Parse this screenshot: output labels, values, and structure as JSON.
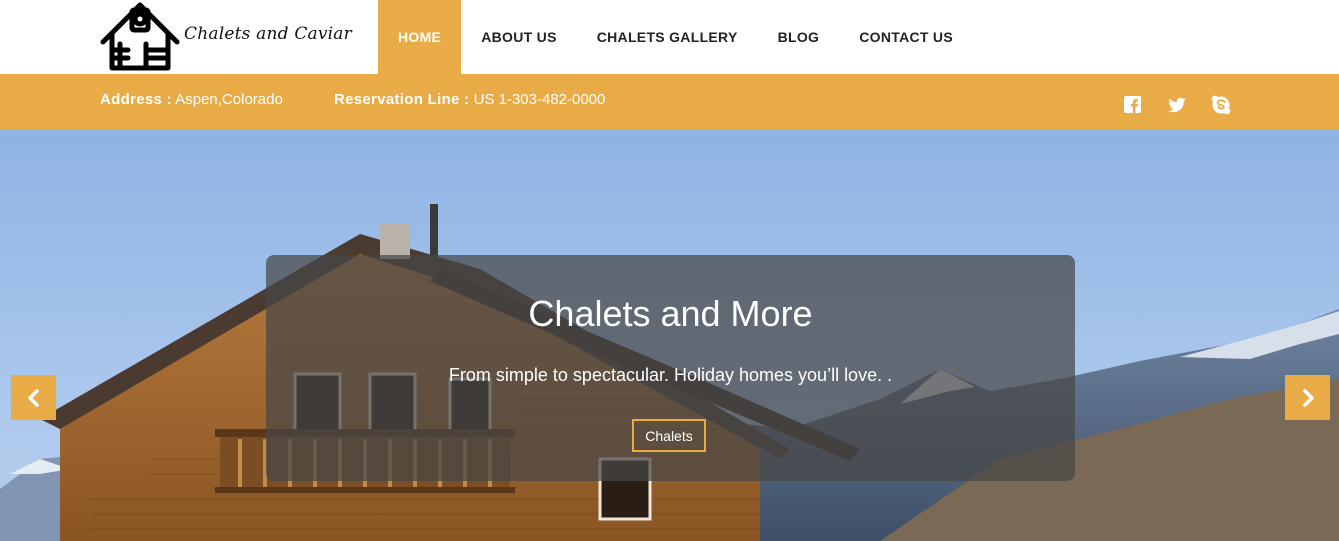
{
  "brand": {
    "name": "Chalets and Caviar",
    "logo_icon": "house-icon"
  },
  "nav": {
    "items": [
      {
        "label": "HOME",
        "active": true
      },
      {
        "label": "ABOUT US",
        "active": false
      },
      {
        "label": "CHALETS GALLERY",
        "active": false
      },
      {
        "label": "BLOG",
        "active": false
      },
      {
        "label": "CONTACT US",
        "active": false
      }
    ]
  },
  "infobar": {
    "address_label": "Address :",
    "address_value": "Aspen,Colorado",
    "reservation_label": "Reservation Line :",
    "reservation_value": "US 1-303-482-0000",
    "social": [
      "facebook-icon",
      "twitter-icon",
      "skype-icon"
    ]
  },
  "hero": {
    "title": "Chalets and More",
    "subtitle": "From simple to spectacular. Holiday homes you’ll love. .",
    "button_label": "Chalets",
    "prev_icon": "chevron-left-icon",
    "next_icon": "chevron-right-icon"
  },
  "colors": {
    "accent": "#e8ab45",
    "overlay": "#464646",
    "text_dark": "#222222"
  }
}
